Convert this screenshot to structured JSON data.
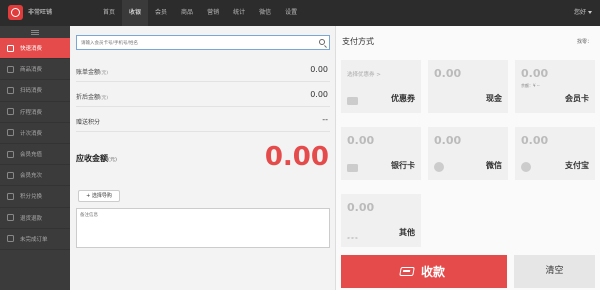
{
  "brand": {
    "name": "非常旺铺"
  },
  "nav": [
    {
      "label": "首页"
    },
    {
      "label": "收银"
    },
    {
      "label": "会员"
    },
    {
      "label": "商品"
    },
    {
      "label": "营销"
    },
    {
      "label": "统计"
    },
    {
      "label": "微信"
    },
    {
      "label": "设置"
    }
  ],
  "nav_active": "收银",
  "user": {
    "greeting": "您好"
  },
  "sidebar": {
    "items": [
      {
        "label": "快速消费"
      },
      {
        "label": "商品消费"
      },
      {
        "label": "扫码消费"
      },
      {
        "label": "疗程消费"
      },
      {
        "label": "计次消费"
      },
      {
        "label": "会员充值"
      },
      {
        "label": "会员充次"
      },
      {
        "label": "积分兑换"
      },
      {
        "label": "退货退款"
      },
      {
        "label": "未完成订单"
      }
    ]
  },
  "order": {
    "search_placeholder": "请输入会员卡号/手机号/姓名",
    "bill_label": "账单金额",
    "bill_unit": "(元)",
    "bill_value": "0.00",
    "discount_label": "折后金额",
    "discount_unit": "(元)",
    "discount_value": "0.00",
    "points_label": "赠送积分",
    "points_value": "--",
    "total_label": "应收金额",
    "total_unit": "(元)",
    "total_value": "0.00",
    "guide_button": "+ 选择导购",
    "note_placeholder": "备注信息"
  },
  "payment": {
    "title": "支付方式",
    "change_label": "找零：",
    "tiles": [
      {
        "amount": "选择优惠券 >",
        "sub": "",
        "name": "优惠券"
      },
      {
        "amount": "0.00",
        "sub": "",
        "name": "现金"
      },
      {
        "amount": "0.00",
        "sub": "余额：¥ --",
        "name": "会员卡"
      },
      {
        "amount": "0.00",
        "sub": "",
        "name": "银行卡"
      },
      {
        "amount": "0.00",
        "sub": "",
        "name": "微信"
      },
      {
        "amount": "0.00",
        "sub": "",
        "name": "支付宝"
      },
      {
        "amount": "0.00",
        "sub": "",
        "name": "其他"
      }
    ],
    "collect_label": "收款",
    "clear_label": "清空"
  },
  "colors": {
    "accent": "#e54b4b",
    "topbar": "#2c2c2c",
    "sidebar": "#3b3b3b"
  }
}
